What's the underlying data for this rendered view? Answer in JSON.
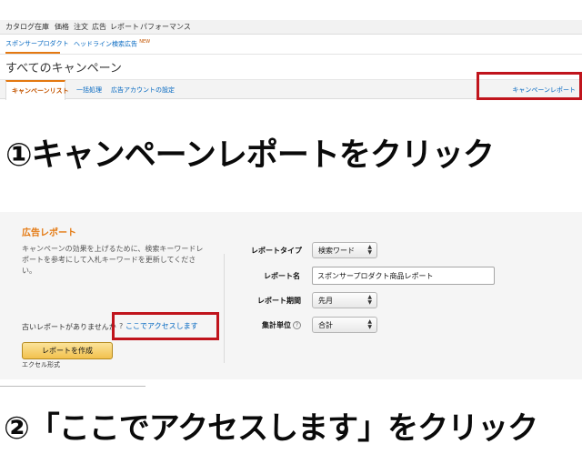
{
  "top_nav": {
    "items": [
      "カタログ",
      "在庫",
      "価格",
      "注文",
      "広告",
      "レポート",
      "パフォーマンス"
    ]
  },
  "sub_nav": {
    "sponsored_products": "スポンサープロダクト",
    "headline_ads": "ヘッドライン検索広告",
    "new_badge": "NEW"
  },
  "page_title": "すべてのキャンペーン",
  "tabs": {
    "campaign_list": "キャンペーンリスト",
    "bulk": "一括処理",
    "ad_account": "広告アカウントの設定",
    "campaign_report": "キャンペーンレポート"
  },
  "steps": {
    "step1": "①キャンペーンレポートをクリック",
    "step2": "②「ここでアクセスします」をクリック"
  },
  "ad_report": {
    "title": "広告レポート",
    "description": "キャンペーンの効果を上げるために、検索キーワードレポートを参考にして入札キーワードを更新してください。",
    "old_report_text": "古いレポートがありませんか",
    "question_mark": "?",
    "access_link": "ここでアクセスします",
    "create_button": "レポートを作成",
    "excel_note": "エクセル形式",
    "form": {
      "report_type_label": "レポートタイプ",
      "report_type_value": "検索ワード",
      "report_name_label": "レポート名",
      "report_name_value": "スポンサープロダクト商品レポート",
      "report_period_label": "レポート期間",
      "report_period_value": "先月",
      "aggregation_label": "集計単位",
      "aggregation_value": "合計",
      "info_icon": "?"
    }
  },
  "colors": {
    "highlight_red": "#c0141c",
    "accent_orange": "#e47911",
    "link_blue": "#0066c0"
  }
}
